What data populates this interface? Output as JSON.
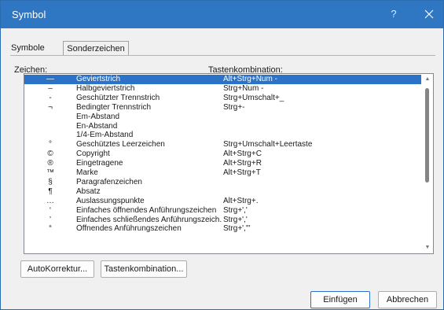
{
  "window": {
    "title": "Symbol",
    "help_label": "?"
  },
  "tabs": [
    {
      "label": "Symbole"
    },
    {
      "label": "Sonderzeichen"
    }
  ],
  "list": {
    "header_char": "Zeichen:",
    "header_key": "Tastenkombination:",
    "selected_index": 0,
    "rows": [
      {
        "char": "—",
        "name": "Geviertstrich",
        "key": "Alt+Strg+Num -"
      },
      {
        "char": "–",
        "name": "Halbgeviertstrich",
        "key": "Strg+Num -"
      },
      {
        "char": "-",
        "name": "Geschützter Trennstrich",
        "key": "Strg+Umschalt+_"
      },
      {
        "char": "¬",
        "name": "Bedingter Trennstrich",
        "key": "Strg+-"
      },
      {
        "char": "",
        "name": "Em-Abstand",
        "key": ""
      },
      {
        "char": "",
        "name": "En-Abstand",
        "key": ""
      },
      {
        "char": "",
        "name": "1/4-Em-Abstand",
        "key": ""
      },
      {
        "char": "°",
        "name": "Geschütztes Leerzeichen",
        "key": "Strg+Umschalt+Leertaste"
      },
      {
        "char": "©",
        "name": "Copyright",
        "key": "Alt+Strg+C"
      },
      {
        "char": "®",
        "name": "Eingetragene",
        "key": "Alt+Strg+R"
      },
      {
        "char": "™",
        "name": "Marke",
        "key": "Alt+Strg+T"
      },
      {
        "char": "§",
        "name": "Paragrafenzeichen",
        "key": ""
      },
      {
        "char": "¶",
        "name": "Absatz",
        "key": ""
      },
      {
        "char": "…",
        "name": "Auslassungspunkte",
        "key": "Alt+Strg+."
      },
      {
        "char": "‘",
        "name": "Einfaches öffnendes Anführungszeichen",
        "key": "Strg+','"
      },
      {
        "char": "’",
        "name": "Einfaches schließendes Anführungszeich...",
        "key": "Strg+','"
      },
      {
        "char": "“",
        "name": "Öffnendes Anführungszeichen",
        "key": "Strg+','\""
      }
    ]
  },
  "buttons": {
    "autokorrektur": "AutoKorrektur...",
    "tastenkombination": "Tastenkombination...",
    "einfuegen": "Einfügen",
    "abbrechen": "Abbrechen"
  }
}
